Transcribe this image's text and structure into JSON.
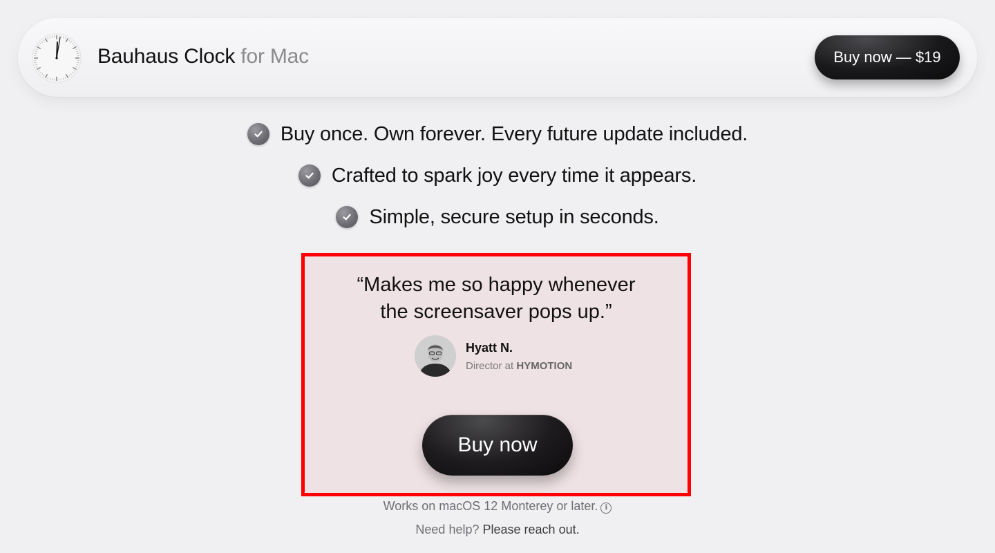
{
  "header": {
    "app_name": "Bauhaus Clock",
    "platform_suffix": "for Mac",
    "buy_label": "Buy now — $19",
    "logo_icon": "clock-icon"
  },
  "features": [
    {
      "icon": "checkmark-icon",
      "text": "Buy once. Own forever. Every future update included."
    },
    {
      "icon": "checkmark-icon",
      "text": "Crafted to spark joy every time it appears."
    },
    {
      "icon": "checkmark-icon",
      "text": "Simple, secure setup in seconds."
    }
  ],
  "testimonial": {
    "quote_line1": "“Makes me so happy whenever",
    "quote_line2": "the screensaver pops up.”",
    "author_name": "Hyatt N.",
    "author_role_prefix": "Director at",
    "author_company": "HYMOTION",
    "highlight_color": "#ff0000"
  },
  "cta": {
    "buy_label": "Buy now"
  },
  "footer": {
    "requirements": "Works on macOS 12 Monterey or later.",
    "info_icon": "info-icon",
    "help_prefix": "Need help?",
    "help_link": "Please reach out."
  }
}
